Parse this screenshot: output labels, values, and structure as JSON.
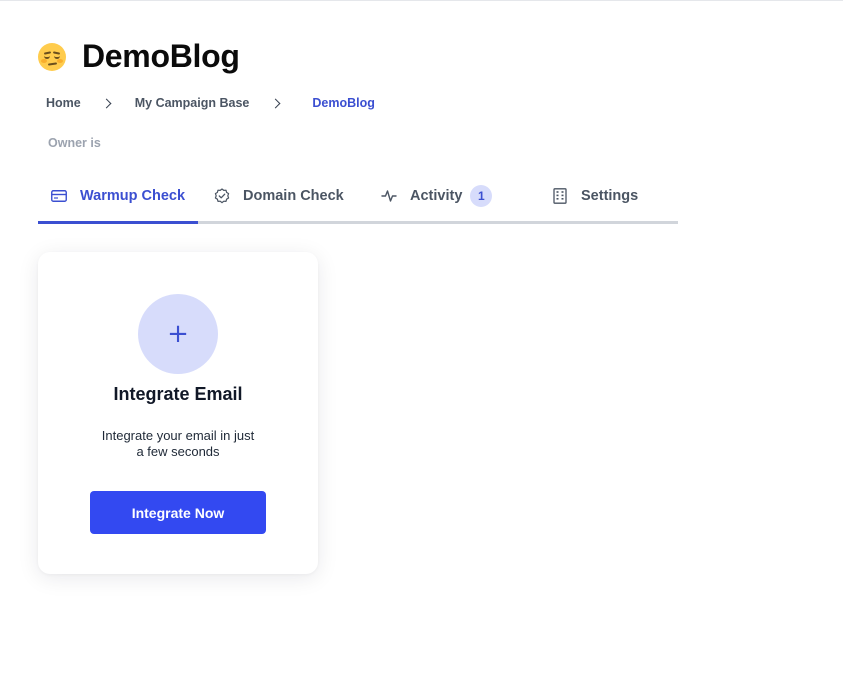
{
  "header": {
    "emoji_icon": "unamused-face-icon",
    "title": "DemoBlog"
  },
  "breadcrumb": {
    "items": [
      "Home",
      "My Campaign Base",
      "DemoBlog"
    ],
    "separator_icon": "chevron-right-icon"
  },
  "owner_text": "Owner is",
  "tabs": [
    {
      "label": "Warmup Check",
      "icon": "card-icon",
      "active": true
    },
    {
      "label": "Domain Check",
      "icon": "badge-check-icon",
      "active": false
    },
    {
      "label": "Activity",
      "icon": "activity-pulse-icon",
      "active": false,
      "badge": "1"
    },
    {
      "label": "Settings",
      "icon": "building-icon",
      "active": false
    }
  ],
  "card": {
    "plus_icon": "plus-icon",
    "plus_glyph": "+",
    "title": "Integrate Email",
    "description": "Integrate your email in just a few seconds",
    "button_label": "Integrate Now"
  },
  "colors": {
    "accent": "#3b4fd1",
    "button": "#3349f1",
    "badge_bg": "#d7dcfb",
    "tab_track": "#d1d5db"
  }
}
